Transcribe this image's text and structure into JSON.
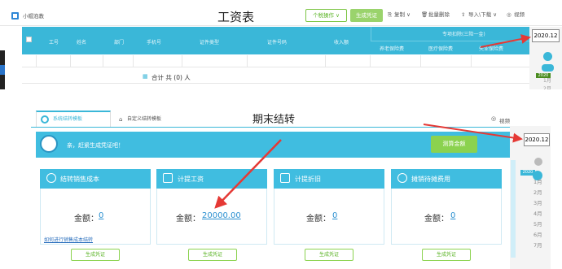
{
  "top": {
    "company": "小帽泡教",
    "title": "工资表",
    "toolbar": {
      "personal_tax": "个税操作 ∨",
      "gen_voucher": "生成凭证",
      "copy": "复制 ∨",
      "batch_delete": "批量删除",
      "import_export": "导入\\下载 ∨",
      "video": "视频"
    },
    "columns": [
      "工号",
      "姓名",
      "部门",
      "手机号",
      "证件类型",
      "证件号码",
      "收入额"
    ],
    "special_group": "专项扣除(三险一金)",
    "special_cols": [
      "养老保险费",
      "医疗保险费",
      "失业保险费"
    ],
    "sum_label": "合计 共 (0) 人",
    "date": "2020.12",
    "side_months": [
      "1月",
      "2月"
    ],
    "side_year": "2020"
  },
  "bottom": {
    "tabs": [
      "系统结转模板",
      "自定义结转模板"
    ],
    "title": "期末结转",
    "video": "视频",
    "banner_text": "亲，赶紧生成凭证吧！",
    "gen_all": "测算金额",
    "cards": [
      {
        "title": "结转销售成本",
        "amount_label": "金额：",
        "amount": "0",
        "button": "生成凭证"
      },
      {
        "title": "计提工资",
        "amount_label": "金额：",
        "amount": "20000.00",
        "button": "生成凭证"
      },
      {
        "title": "计提折旧",
        "amount_label": "金额：",
        "amount": "0",
        "button": "生成凭证"
      },
      {
        "title": "摊销待摊费用",
        "amount_label": "金额：",
        "amount": "0",
        "button": "生成凭证"
      }
    ],
    "help_link": "如何进行销售成本结转",
    "date": "2020.12",
    "year": "2020",
    "months": [
      "1月",
      "2月",
      "3月",
      "4月",
      "5月",
      "6月",
      "7月"
    ]
  },
  "colors": {
    "accent": "#3ab7d8",
    "green": "#8bd24f",
    "arrow": "#e53935"
  }
}
